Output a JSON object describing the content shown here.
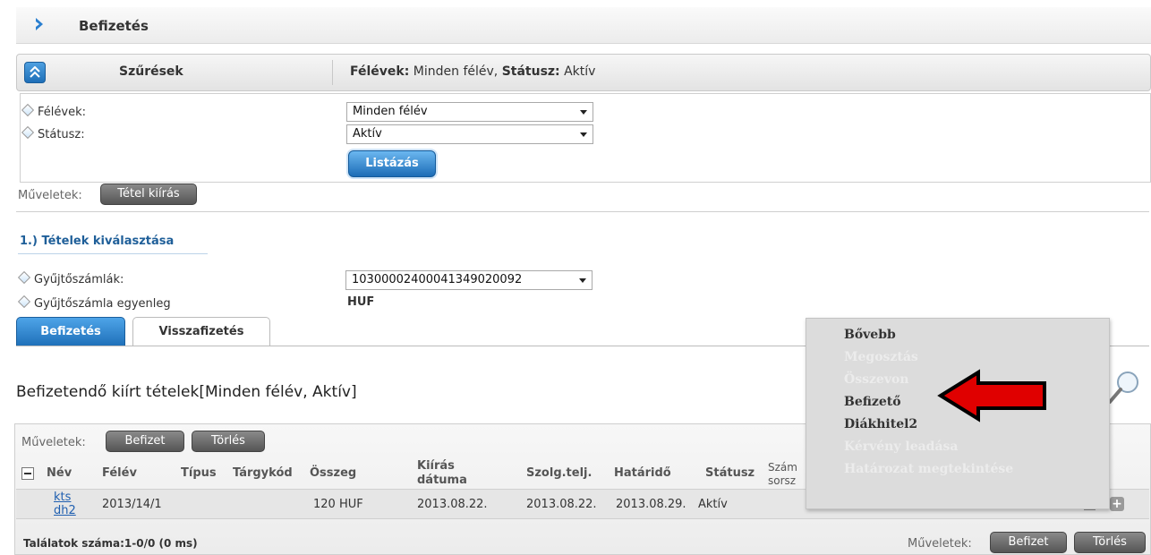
{
  "header": {
    "title": "Befizetés"
  },
  "filter": {
    "title": "Szűrések",
    "summary_label1": "Félévek:",
    "summary_value1": "Minden félév,",
    "summary_label2": "Státusz:",
    "summary_value2": "Aktív",
    "felevek_label": "Félévek:",
    "felevek_value": "Minden félév",
    "statusz_label": "Státusz:",
    "statusz_value": "Aktív",
    "list_button": "Listázás"
  },
  "ops1": {
    "label": "Műveletek:",
    "button": "Tétel kiírás"
  },
  "section": {
    "title": "1.) Tételek kiválasztása"
  },
  "account": {
    "label": "Gyűjtőszámlák:",
    "value": "10300002400041349020092",
    "balance_label": "Gyűjtőszámla egyenleg",
    "balance_value": "HUF"
  },
  "tabs": [
    {
      "label": "Befizetés",
      "active": true
    },
    {
      "label": "Visszafizetés",
      "active": false
    }
  ],
  "results": {
    "title": "Befizetendő kiírt tételek[Minden félév, Aktív]"
  },
  "grid_ops": {
    "label": "Műveletek:",
    "pay": "Befizet",
    "delete": "Törlés"
  },
  "columns": [
    "Név",
    "Félév",
    "Típus",
    "Tárgykód",
    "Összeg",
    "Kiírás",
    "dátuma",
    "Szolg.telj.",
    "Határidő",
    "Státusz",
    "Szám",
    "sorsz"
  ],
  "rows": [
    {
      "name_line1": "kts",
      "name_line2": "dh2",
      "semester": "2013/14/1",
      "amount": "120 HUF",
      "issue_date": "2013.08.22.",
      "service_date": "2013.08.22.",
      "deadline": "2013.08.29.",
      "status": "Aktív"
    }
  ],
  "footer": {
    "count": "Találatok száma:1-0/0 (0 ms)",
    "ops_label": "Műveletek:",
    "pay": "Befizet",
    "delete": "Törlés"
  },
  "context_menu": {
    "items": [
      {
        "label": "Bővebb",
        "enabled": true
      },
      {
        "label": "Megosztás",
        "enabled": false
      },
      {
        "label": "Összevon",
        "enabled": false
      },
      {
        "label": "Befizető",
        "enabled": true
      },
      {
        "label": "Diákhitel2",
        "enabled": true
      },
      {
        "label": "Kérvény leadása",
        "enabled": false
      },
      {
        "label": "Határozat megtekintése",
        "enabled": false
      }
    ]
  },
  "colors": {
    "accent_blue": "#1e6fb8",
    "arrow_red": "#e00000",
    "row_bg": "#e6e6e6"
  }
}
